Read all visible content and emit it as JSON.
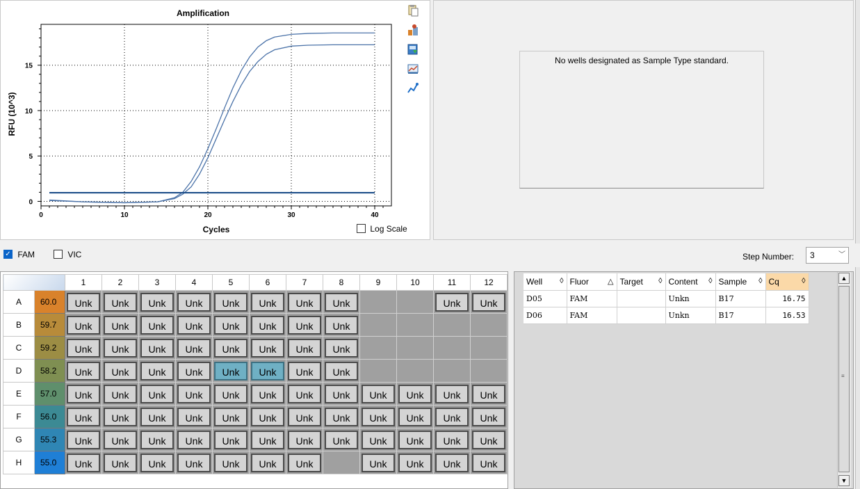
{
  "chart": {
    "title": "Amplification",
    "ylabel": "RFU (10^3)",
    "xlabel": "Cycles",
    "log_scale_label": "Log Scale",
    "log_scale_checked": false,
    "x_ticks": [
      "0",
      "10",
      "20",
      "30",
      "40"
    ],
    "y_ticks": [
      "0",
      "5",
      "10",
      "15"
    ]
  },
  "chart_data": {
    "type": "line",
    "title": "Amplification",
    "xlabel": "Cycles",
    "ylabel": "RFU (10^3)",
    "xlim": [
      0,
      42
    ],
    "ylim": [
      -0.5,
      19.5
    ],
    "grid": true,
    "series": [
      {
        "name": "",
        "x": [
          1,
          5,
          10,
          14,
          16,
          17,
          18,
          19,
          20,
          21,
          22,
          23,
          24,
          25,
          26,
          27,
          28,
          30,
          32,
          35,
          40
        ],
        "y": [
          0.15,
          -0.05,
          -0.15,
          -0.05,
          0.4,
          1.0,
          2.2,
          3.8,
          5.8,
          8.0,
          10.3,
          12.5,
          14.4,
          15.9,
          17.0,
          17.7,
          18.1,
          18.4,
          18.5,
          18.55,
          18.55
        ]
      },
      {
        "name": "",
        "x": [
          1,
          5,
          10,
          14,
          16,
          17,
          18,
          19,
          20,
          21,
          22,
          23,
          24,
          25,
          26,
          27,
          28,
          30,
          32,
          35,
          40
        ],
        "y": [
          0.1,
          -0.05,
          -0.15,
          -0.05,
          0.3,
          0.8,
          1.6,
          3.0,
          4.8,
          6.9,
          9.0,
          11.0,
          12.8,
          14.3,
          15.4,
          16.2,
          16.7,
          17.1,
          17.2,
          17.25,
          17.25
        ]
      },
      {
        "name": "",
        "x": [
          1,
          40
        ],
        "y": [
          0.95,
          0.95
        ]
      }
    ]
  },
  "tool_icons": [
    "copy-icon",
    "export-icon",
    "save-image-icon",
    "chart-settings-icon",
    "fit-curve-icon"
  ],
  "standard_panel": {
    "message": "No wells designated as Sample Type standard."
  },
  "fluors": [
    {
      "label": "FAM",
      "checked": true
    },
    {
      "label": "VIC",
      "checked": false
    }
  ],
  "step": {
    "label": "Step Number:",
    "value": "3"
  },
  "plate": {
    "columns": [
      "1",
      "2",
      "3",
      "4",
      "5",
      "6",
      "7",
      "8",
      "9",
      "10",
      "11",
      "12"
    ],
    "rows": [
      {
        "label": "A",
        "temp": "60.0",
        "color": "#d9822b",
        "wells": [
          "Unk",
          "Unk",
          "Unk",
          "Unk",
          "Unk",
          "Unk",
          "Unk",
          "Unk",
          "",
          "",
          "Unk",
          "Unk"
        ]
      },
      {
        "label": "B",
        "temp": "59.7",
        "color": "#b88b3a",
        "wells": [
          "Unk",
          "Unk",
          "Unk",
          "Unk",
          "Unk",
          "Unk",
          "Unk",
          "Unk",
          "",
          "",
          "",
          ""
        ]
      },
      {
        "label": "C",
        "temp": "59.2",
        "color": "#9c8d44",
        "wells": [
          "Unk",
          "Unk",
          "Unk",
          "Unk",
          "Unk",
          "Unk",
          "Unk",
          "Unk",
          "",
          "",
          "",
          ""
        ]
      },
      {
        "label": "D",
        "temp": "58.2",
        "color": "#7f8f52",
        "wells": [
          "Unk",
          "Unk",
          "Unk",
          "Unk",
          "Unk",
          "Unk",
          "Unk",
          "Unk",
          "",
          "",
          "",
          ""
        ]
      },
      {
        "label": "E",
        "temp": "57.0",
        "color": "#5f8f6c",
        "wells": [
          "Unk",
          "Unk",
          "Unk",
          "Unk",
          "Unk",
          "Unk",
          "Unk",
          "Unk",
          "Unk",
          "Unk",
          "Unk",
          "Unk"
        ]
      },
      {
        "label": "F",
        "temp": "56.0",
        "color": "#3c8a94",
        "wells": [
          "Unk",
          "Unk",
          "Unk",
          "Unk",
          "Unk",
          "Unk",
          "Unk",
          "Unk",
          "Unk",
          "Unk",
          "Unk",
          "Unk"
        ]
      },
      {
        "label": "G",
        "temp": "55.3",
        "color": "#2f86b4",
        "wells": [
          "Unk",
          "Unk",
          "Unk",
          "Unk",
          "Unk",
          "Unk",
          "Unk",
          "Unk",
          "Unk",
          "Unk",
          "Unk",
          "Unk"
        ]
      },
      {
        "label": "H",
        "temp": "55.0",
        "color": "#1f7fd6",
        "wells": [
          "Unk",
          "Unk",
          "Unk",
          "Unk",
          "Unk",
          "Unk",
          "Unk",
          "",
          "",
          "Unk",
          "Unk",
          "Unk",
          "Unk"
        ]
      }
    ],
    "selected": [
      "D5",
      "D6"
    ]
  },
  "results": {
    "headers": [
      {
        "label": "Well",
        "sort": "◊"
      },
      {
        "label": "Fluor",
        "sort": "△"
      },
      {
        "label": "Target",
        "sort": "◊"
      },
      {
        "label": "Content",
        "sort": "◊"
      },
      {
        "label": "Sample",
        "sort": "◊"
      },
      {
        "label": "Cq",
        "sort": "◊"
      }
    ],
    "rows": [
      [
        "D05",
        "FAM",
        "",
        "Unkn",
        "B17",
        "16.75"
      ],
      [
        "D06",
        "FAM",
        "",
        "Unkn",
        "B17",
        "16.53"
      ]
    ]
  }
}
